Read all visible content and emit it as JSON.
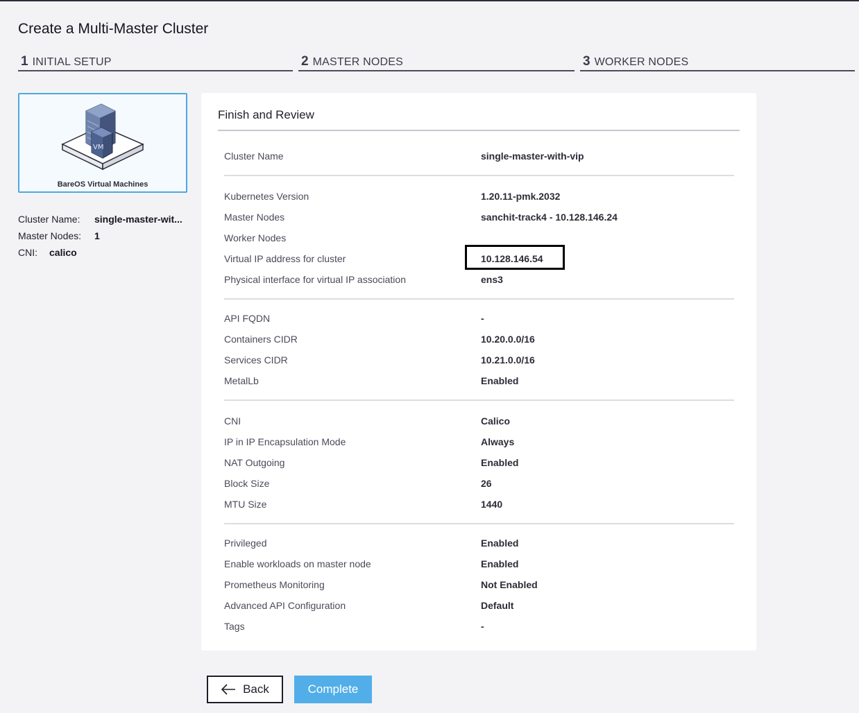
{
  "page": {
    "title": "Create a Multi-Master Cluster"
  },
  "steps": [
    {
      "num": "1",
      "label": "INITIAL SETUP"
    },
    {
      "num": "2",
      "label": "MASTER NODES"
    },
    {
      "num": "3",
      "label": "WORKER NODES"
    }
  ],
  "card": {
    "label": "BareOS Virtual Machines",
    "badge": "VM"
  },
  "summary": {
    "cluster_name_label": "Cluster Name:",
    "cluster_name_value": "single-master-wit...",
    "master_nodes_label": "Master Nodes:",
    "master_nodes_value": "1",
    "cni_label": "CNI:",
    "cni_value": "calico"
  },
  "review": {
    "title": "Finish and Review",
    "groups": [
      [
        {
          "key": "Cluster Name",
          "value": "single-master-with-vip"
        }
      ],
      [
        {
          "key": "Kubernetes Version",
          "value": "1.20.11-pmk.2032"
        },
        {
          "key": "Master Nodes",
          "value": "sanchit-track4 - 10.128.146.24"
        },
        {
          "key": "Worker Nodes",
          "value": ""
        },
        {
          "key": "Virtual IP address for cluster",
          "value": "10.128.146.54"
        },
        {
          "key": "Physical interface for virtual IP association",
          "value": "ens3"
        }
      ],
      [
        {
          "key": "API FQDN",
          "value": "-"
        },
        {
          "key": "Containers CIDR",
          "value": "10.20.0.0/16"
        },
        {
          "key": "Services CIDR",
          "value": "10.21.0.0/16"
        },
        {
          "key": "MetalLb",
          "value": "Enabled"
        }
      ],
      [
        {
          "key": "CNI",
          "value": "Calico"
        },
        {
          "key": "IP in IP Encapsulation Mode",
          "value": "Always"
        },
        {
          "key": "NAT Outgoing",
          "value": "Enabled"
        },
        {
          "key": "Block Size",
          "value": "26"
        },
        {
          "key": "MTU Size",
          "value": "1440"
        }
      ],
      [
        {
          "key": "Privileged",
          "value": "Enabled"
        },
        {
          "key": "Enable workloads on master node",
          "value": "Enabled"
        },
        {
          "key": "Prometheus Monitoring",
          "value": "Not Enabled"
        },
        {
          "key": "Advanced API Configuration",
          "value": "Default"
        },
        {
          "key": "Tags",
          "value": "-"
        }
      ]
    ]
  },
  "buttons": {
    "back": "Back",
    "complete": "Complete"
  },
  "icons": {
    "back_arrow": "arrow-left-icon"
  },
  "colors": {
    "accent": "#52aee8",
    "card_border": "#4ea8e0",
    "highlight": "#000000"
  }
}
